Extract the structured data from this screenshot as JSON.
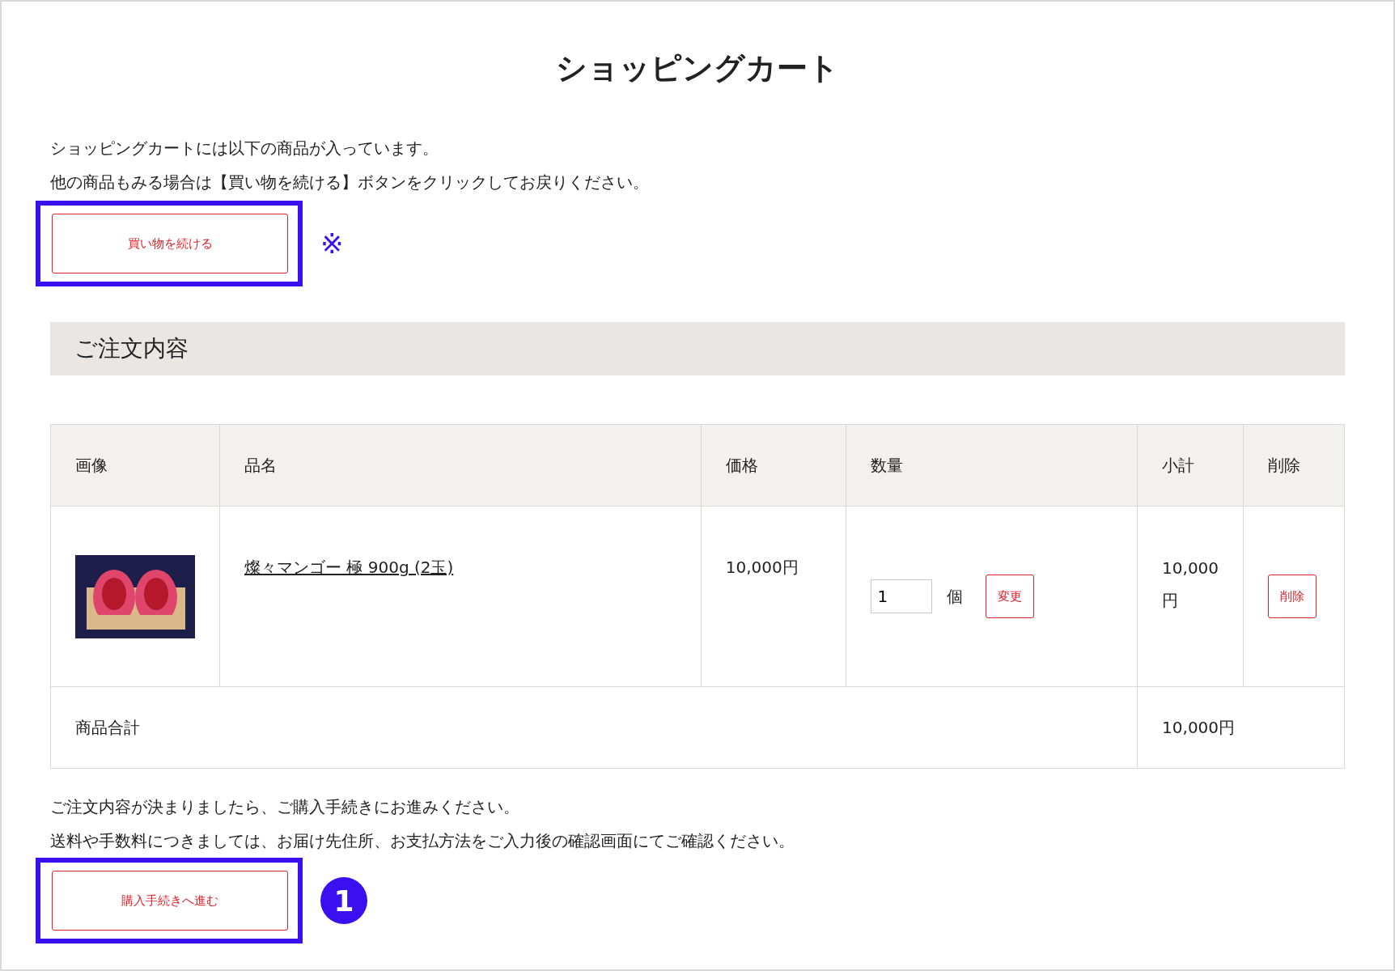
{
  "page": {
    "title": "ショッピングカート"
  },
  "intro": [
    "ショッピングカートには以下の商品が入っています。",
    "他の商品もみる場合は【買い物を続ける】ボタンをクリックしてお戻りください。"
  ],
  "continue_button": {
    "label": "買い物を続ける",
    "highlighted": true,
    "annotation": "※"
  },
  "section": {
    "heading": "ご注文内容"
  },
  "table": {
    "columns": [
      "画像",
      "品名",
      "価格",
      "数量",
      "小計",
      "削除"
    ],
    "rows": [
      {
        "name": "燦々マンゴー 極 900g (2玉)",
        "price": "10,000円",
        "quantity": "1",
        "unit": "個",
        "change_button": "変更",
        "subtotal": "10,000円",
        "delete_button": "削除"
      }
    ],
    "total": {
      "label": "商品合計",
      "value": "10,000円"
    }
  },
  "outro": [
    "ご注文内容が決まりましたら、ご購入手続きにお進みください。",
    "送料や手数料につきましては、お届け先住所、お支払方法をご入力後の確認画面にてご確認ください。"
  ],
  "checkout_button": {
    "label": "購入手続きへ進む",
    "highlighted": true,
    "annotation": "1"
  }
}
